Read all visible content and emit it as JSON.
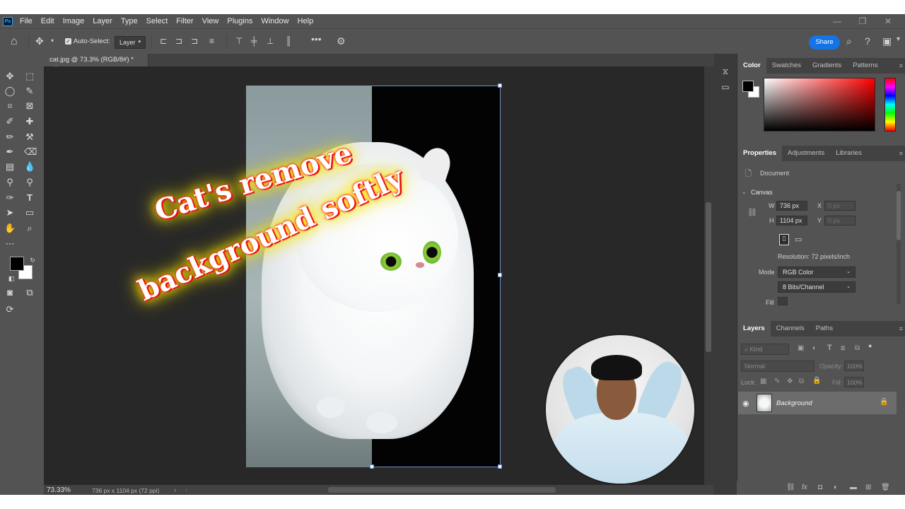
{
  "menu": {
    "logo": "Ps",
    "items": [
      "File",
      "Edit",
      "Image",
      "Layer",
      "Type",
      "Select",
      "Filter",
      "View",
      "Plugins",
      "Window",
      "Help"
    ],
    "window_controls": [
      "—",
      "❐",
      "✕"
    ]
  },
  "options_bar": {
    "auto_select_label": "Auto-Select:",
    "auto_select_checked": true,
    "layer_select_value": "Layer",
    "share_label": "Share"
  },
  "document": {
    "tab_title": "cat.jpg @ 73.3% (RGB/8#) *",
    "zoom": "73.33%",
    "info": "736 px x 1104 px (72 ppi)"
  },
  "overlay": {
    "line1": "Cat's remove",
    "line2": "background softly"
  },
  "panels": {
    "color_tabs": [
      "Color",
      "Swatches",
      "Gradients",
      "Patterns"
    ],
    "props_tabs": [
      "Properties",
      "Adjustments",
      "Libraries"
    ],
    "props_doc_label": "Document",
    "canvas_section": "Canvas",
    "width_label": "W",
    "width_value": "736 px",
    "height_label": "H",
    "height_value": "1104 px",
    "x_label": "X",
    "x_placeholder": "0 px",
    "y_label": "Y",
    "y_placeholder": "0 px",
    "resolution": "Resolution: 72 pixels/inch",
    "mode_label": "Mode",
    "mode_value": "RGB Color",
    "bits_value": "8 Bits/Channel",
    "fill_label": "Fill",
    "layers_tabs": [
      "Layers",
      "Channels",
      "Paths"
    ],
    "kind_label": "Kind",
    "blend_mode": "Normal",
    "opacity_label": "Opacity:",
    "opacity_value": "100%",
    "lock_label": "Lock:",
    "fill_value_label": "Fill:",
    "fill_value": "100%",
    "layer_name": "Background"
  },
  "colors": {
    "accent": "#1473e6",
    "app_bg": "#535353",
    "canvas_bg": "#282828",
    "overlay_glow": "#f5e000",
    "overlay_stroke": "#e01010"
  }
}
